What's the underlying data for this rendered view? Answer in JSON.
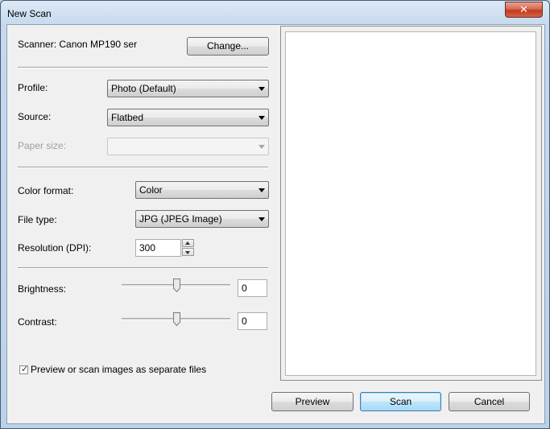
{
  "window": {
    "title": "New Scan",
    "close_glyph": "✕"
  },
  "scanner": {
    "label": "Scanner: Canon MP190 ser",
    "change_button": "Change..."
  },
  "profile": {
    "label": "Profile:",
    "value": "Photo (Default)"
  },
  "source": {
    "label": "Source:",
    "value": "Flatbed"
  },
  "paper_size": {
    "label": "Paper size:",
    "value": ""
  },
  "color_format": {
    "label": "Color format:",
    "value": "Color"
  },
  "file_type": {
    "label": "File type:",
    "value": "JPG (JPEG Image)"
  },
  "resolution": {
    "label": "Resolution (DPI):",
    "value": "300"
  },
  "brightness": {
    "label": "Brightness:",
    "value": "0",
    "level": 0.5
  },
  "contrast": {
    "label": "Contrast:",
    "value": "0",
    "level": 0.5
  },
  "separate_files": {
    "label": "Preview or scan images as separate files",
    "checked": true
  },
  "buttons": {
    "preview": "Preview",
    "scan": "Scan",
    "cancel": "Cancel"
  }
}
